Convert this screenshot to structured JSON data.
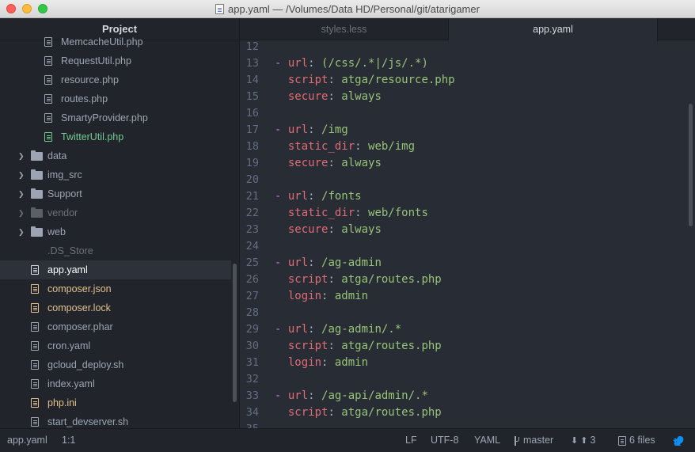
{
  "window": {
    "title": "app.yaml — /Volumes/Data HD/Personal/git/atarigamer",
    "icon": "yaml-file-icon"
  },
  "sidebar": {
    "header": "Project",
    "items": [
      {
        "label": "MemcacheUtil.php",
        "type": "file",
        "status": "normal",
        "depth": 2
      },
      {
        "label": "RequestUtil.php",
        "type": "file",
        "status": "normal",
        "depth": 2
      },
      {
        "label": "resource.php",
        "type": "file",
        "status": "normal",
        "depth": 2
      },
      {
        "label": "routes.php",
        "type": "file",
        "status": "normal",
        "depth": 2
      },
      {
        "label": "SmartyProvider.php",
        "type": "file",
        "status": "normal",
        "depth": 2
      },
      {
        "label": "TwitterUtil.php",
        "type": "file",
        "status": "added",
        "depth": 2
      },
      {
        "label": "data",
        "type": "folder",
        "status": "normal",
        "depth": 1
      },
      {
        "label": "img_src",
        "type": "folder",
        "status": "normal",
        "depth": 1
      },
      {
        "label": "Support",
        "type": "folder",
        "status": "normal",
        "depth": 1
      },
      {
        "label": "vendor",
        "type": "folder",
        "status": "ignored",
        "depth": 1
      },
      {
        "label": "web",
        "type": "folder",
        "status": "normal",
        "depth": 1
      },
      {
        "label": ".DS_Store",
        "type": "none",
        "status": "ignored",
        "depth": 1
      },
      {
        "label": "app.yaml",
        "type": "file",
        "status": "selected",
        "depth": 1
      },
      {
        "label": "composer.json",
        "type": "file",
        "status": "modified",
        "depth": 1
      },
      {
        "label": "composer.lock",
        "type": "file",
        "status": "modified",
        "depth": 1
      },
      {
        "label": "composer.phar",
        "type": "file",
        "status": "normal",
        "depth": 1
      },
      {
        "label": "cron.yaml",
        "type": "file",
        "status": "normal",
        "depth": 1
      },
      {
        "label": "gcloud_deploy.sh",
        "type": "file",
        "status": "normal",
        "depth": 1
      },
      {
        "label": "index.yaml",
        "type": "file",
        "status": "normal",
        "depth": 1
      },
      {
        "label": "php.ini",
        "type": "file",
        "status": "modified",
        "depth": 1
      },
      {
        "label": "start_devserver.sh",
        "type": "file",
        "status": "normal",
        "depth": 1
      }
    ]
  },
  "tabs": [
    {
      "label": "styles.less",
      "active": false
    },
    {
      "label": "app.yaml",
      "active": true
    }
  ],
  "editor": {
    "lines": [
      {
        "n": "12",
        "dash": false,
        "key": "",
        "value": ""
      },
      {
        "n": "13",
        "dash": true,
        "key": "url",
        "value": "(/css/.*|/js/.*)"
      },
      {
        "n": "14",
        "dash": false,
        "key": "script",
        "value": "atga/resource.php"
      },
      {
        "n": "15",
        "dash": false,
        "key": "secure",
        "value": "always"
      },
      {
        "n": "16",
        "dash": false,
        "key": "",
        "value": ""
      },
      {
        "n": "17",
        "dash": true,
        "key": "url",
        "value": "/img"
      },
      {
        "n": "18",
        "dash": false,
        "key": "static_dir",
        "value": "web/img"
      },
      {
        "n": "19",
        "dash": false,
        "key": "secure",
        "value": "always"
      },
      {
        "n": "20",
        "dash": false,
        "key": "",
        "value": ""
      },
      {
        "n": "21",
        "dash": true,
        "key": "url",
        "value": "/fonts"
      },
      {
        "n": "22",
        "dash": false,
        "key": "static_dir",
        "value": "web/fonts"
      },
      {
        "n": "23",
        "dash": false,
        "key": "secure",
        "value": "always"
      },
      {
        "n": "24",
        "dash": false,
        "key": "",
        "value": ""
      },
      {
        "n": "25",
        "dash": true,
        "key": "url",
        "value": "/ag-admin"
      },
      {
        "n": "26",
        "dash": false,
        "key": "script",
        "value": "atga/routes.php"
      },
      {
        "n": "27",
        "dash": false,
        "key": "login",
        "value": "admin"
      },
      {
        "n": "28",
        "dash": false,
        "key": "",
        "value": ""
      },
      {
        "n": "29",
        "dash": true,
        "key": "url",
        "value": "/ag-admin/.*"
      },
      {
        "n": "30",
        "dash": false,
        "key": "script",
        "value": "atga/routes.php"
      },
      {
        "n": "31",
        "dash": false,
        "key": "login",
        "value": "admin"
      },
      {
        "n": "32",
        "dash": false,
        "key": "",
        "value": ""
      },
      {
        "n": "33",
        "dash": true,
        "key": "url",
        "value": "/ag-api/admin/.*"
      },
      {
        "n": "34",
        "dash": false,
        "key": "script",
        "value": "atga/routes.php"
      },
      {
        "n": "35",
        "dash": false,
        "key": "",
        "value": ""
      }
    ]
  },
  "statusbar": {
    "file": "app.yaml",
    "cursor": "1:1",
    "line_ending": "LF",
    "encoding": "UTF-8",
    "grammar": "YAML",
    "branch": "master",
    "push_count": "3",
    "files_label": "6 files"
  },
  "colors": {
    "key": "#e06c75",
    "value": "#98c379",
    "dash": "#c678dd",
    "git_added": "#73c990",
    "git_modified": "#e2c08d",
    "accent": "#0e8ff0"
  }
}
